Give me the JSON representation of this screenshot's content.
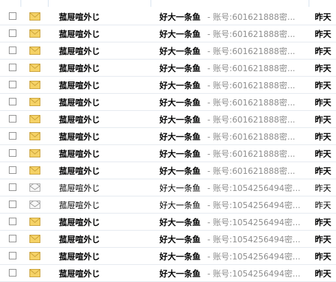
{
  "mail_list": {
    "rows": [
      {
        "unread": true,
        "sender": "菰屉喧外じ",
        "subject": "好大一条鱼",
        "preview": " - 账号:601621888密...",
        "date": "昨天"
      },
      {
        "unread": true,
        "sender": "菰屉喧外じ",
        "subject": "好大一条鱼",
        "preview": " - 账号:601621888密...",
        "date": "昨天"
      },
      {
        "unread": true,
        "sender": "菰屉喧外じ",
        "subject": "好大一条鱼",
        "preview": " - 账号:601621888密...",
        "date": "昨天"
      },
      {
        "unread": true,
        "sender": "菰屉喧外じ",
        "subject": "好大一条鱼",
        "preview": " - 账号:601621888密...",
        "date": "昨天"
      },
      {
        "unread": true,
        "sender": "菰屉喧外じ",
        "subject": "好大一条鱼",
        "preview": " - 账号:601621888密...",
        "date": "昨天"
      },
      {
        "unread": true,
        "sender": "菰屉喧外じ",
        "subject": "好大一条鱼",
        "preview": " - 账号:601621888密...",
        "date": "昨天"
      },
      {
        "unread": true,
        "sender": "菰屉喧外じ",
        "subject": "好大一条鱼",
        "preview": " - 账号:601621888密...",
        "date": "昨天"
      },
      {
        "unread": true,
        "sender": "菰屉喧外じ",
        "subject": "好大一条鱼",
        "preview": " - 账号:601621888密...",
        "date": "昨天"
      },
      {
        "unread": true,
        "sender": "菰屉喧外じ",
        "subject": "好大一条鱼",
        "preview": " - 账号:601621888密...",
        "date": "昨天"
      },
      {
        "unread": true,
        "sender": "菰屉喧外じ",
        "subject": "好大一条鱼",
        "preview": " - 账号:601621888密...",
        "date": "昨天"
      },
      {
        "unread": false,
        "sender": "菰屉喧外じ",
        "subject": "好大一条鱼",
        "preview": " - 账号:1054256494密...",
        "date": "昨天"
      },
      {
        "unread": false,
        "sender": "菰屉喧外じ",
        "subject": "好大一条鱼",
        "preview": " - 账号:1054256494密...",
        "date": "昨天"
      },
      {
        "unread": true,
        "sender": "菰屉喧外じ",
        "subject": "好大一条鱼",
        "preview": " - 账号:1054256494密...",
        "date": "昨天"
      },
      {
        "unread": true,
        "sender": "菰屉喧外じ",
        "subject": "好大一条鱼",
        "preview": " - 账号:1054256494密...",
        "date": "昨天"
      },
      {
        "unread": true,
        "sender": "菰屉喧外じ",
        "subject": "好大一条鱼",
        "preview": " - 账号:1054256494密...",
        "date": "昨天"
      },
      {
        "unread": true,
        "sender": "菰屉喧外じ",
        "subject": "好大一条鱼",
        "preview": " - 账号:1054256494密...",
        "date": "昨天"
      }
    ]
  },
  "icons": {
    "unread_envelope": "closed-envelope-icon",
    "read_envelope": "open-envelope-icon"
  },
  "colors": {
    "unread_envelope": "#f5d266",
    "preview_text": "#8e8e8e",
    "row_divider": "#e4e9ef"
  }
}
